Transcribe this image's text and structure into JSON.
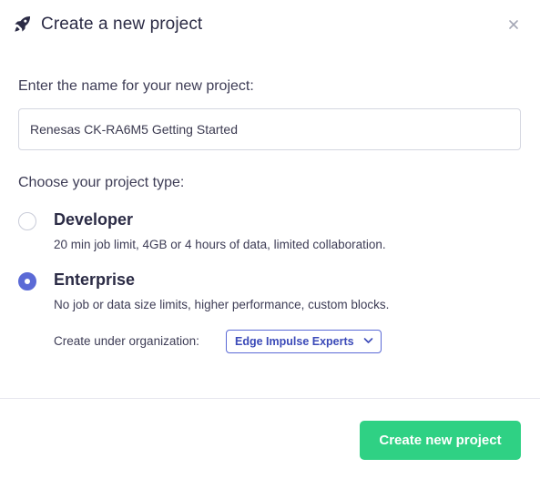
{
  "dialog": {
    "title": "Create a new project",
    "title_icon": "rocket-icon",
    "close_icon": "close-icon"
  },
  "form": {
    "name_label": "Enter the name for your new project:",
    "name_value": "Renesas CK-RA6M5 Getting Started",
    "type_label": "Choose your project type:",
    "options": [
      {
        "title": "Developer",
        "description": "20 min job limit, 4GB or 4 hours of data, limited collaboration.",
        "selected": false
      },
      {
        "title": "Enterprise",
        "description": "No job or data size limits, higher performance, custom blocks.",
        "selected": true
      }
    ],
    "org_label": "Create under organization:",
    "org_selected": "Edge Impulse Experts"
  },
  "footer": {
    "create_label": "Create new project"
  },
  "colors": {
    "accent": "#5b6ad6",
    "primary_button": "#2fd184",
    "title_text": "#2b2b45"
  }
}
